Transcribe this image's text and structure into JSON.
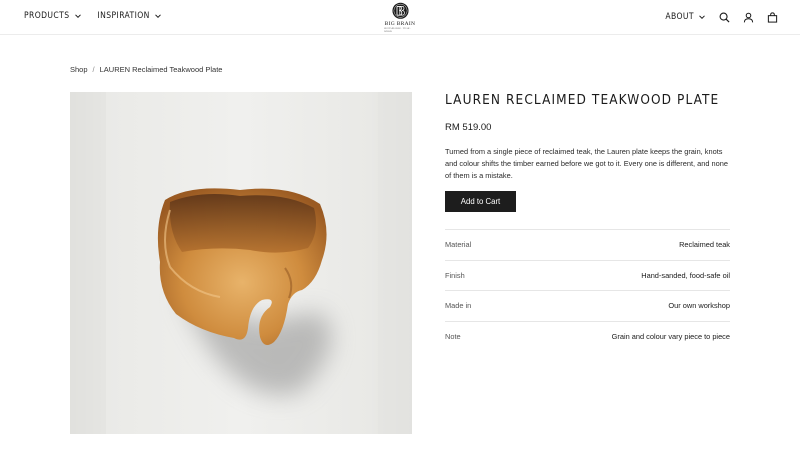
{
  "header": {
    "nav_left": [
      {
        "label": "PRODUCTS"
      },
      {
        "label": "INSPIRATION"
      }
    ],
    "logo": {
      "name": "BIG BRAIN",
      "tagline": "SUSTAINABLE · TEAK · WOOD"
    },
    "nav_right": {
      "about_label": "ABOUT"
    },
    "icons": [
      "search-icon",
      "account-icon",
      "cart-icon"
    ]
  },
  "breadcrumb": {
    "parent": "Shop",
    "separator": "/",
    "current": "LAUREN Reclaimed Teakwood Plate"
  },
  "product": {
    "title": "LAUREN RECLAIMED TEAKWOOD PLATE",
    "price": "RM 519.00",
    "description": "Turned from a single piece of reclaimed teak, the Lauren plate keeps the grain, knots and colour shifts the timber earned before we got to it. Every one is different, and none of them is a mistake.",
    "add_to_cart_label": "Add to Cart",
    "specs": [
      {
        "label": "Material",
        "value": "Reclaimed teak"
      },
      {
        "label": "Finish",
        "value": "Hand-sanded, food-safe oil"
      },
      {
        "label": "Made in",
        "value": "Our own workshop"
      },
      {
        "label": "Note",
        "value": "Grain and colour vary piece to piece"
      }
    ]
  },
  "colors": {
    "button_bg": "#1d1d1d",
    "border": "#e6e6e6",
    "wood": "#c98a3e"
  }
}
